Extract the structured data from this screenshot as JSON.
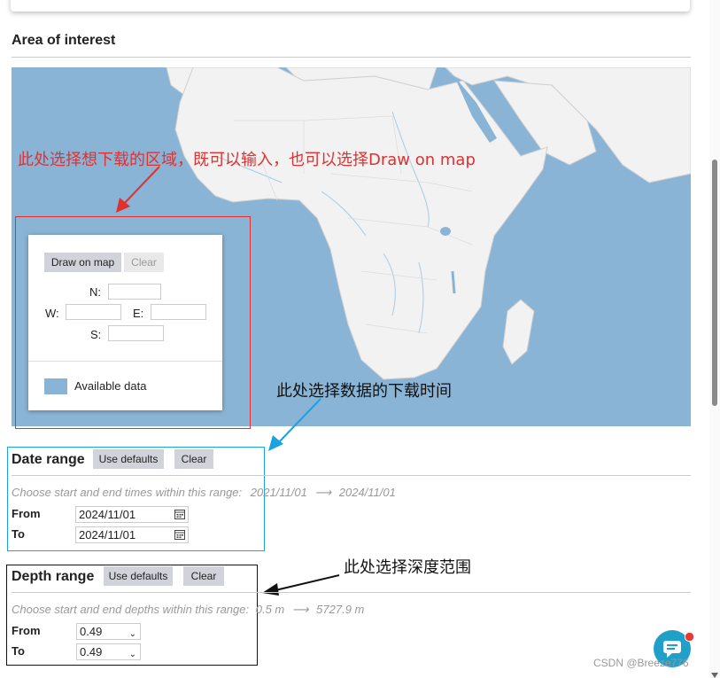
{
  "area": {
    "title": "Area of interest",
    "draw_button": "Draw on map",
    "clear_button": "Clear",
    "n_label": "N:",
    "w_label": "W:",
    "e_label": "E:",
    "s_label": "S:",
    "legend_label": "Available data",
    "legend_color": "#8ab4d6"
  },
  "annotations": {
    "area_note": "此处选择想下载的区域，既可以输入，也可以选择Draw on map",
    "date_note": "此处选择数据的下载时间",
    "depth_note": "此处选择深度范围",
    "area_color": "#e03030",
    "date_color": "#1aa3e0",
    "depth_color": "#111111"
  },
  "date_range": {
    "title": "Date range",
    "use_defaults": "Use defaults",
    "clear": "Clear",
    "hint": "Choose start and end times within this range:",
    "range_start": "2021/11/01",
    "arrow": "⟶",
    "range_end": "2024/11/01",
    "from_label": "From",
    "from_value": "2024/11/01",
    "to_label": "To",
    "to_value": "2024/11/01"
  },
  "depth_range": {
    "title": "Depth range",
    "use_defaults": "Use defaults",
    "clear": "Clear",
    "hint": "Choose start and end depths within this range:",
    "range_start": "0.5 m",
    "arrow": "⟶",
    "range_end": "5727.9 m",
    "from_label": "From",
    "from_value": "0.49",
    "to_label": "To",
    "to_value": "0.49"
  },
  "watermark": "CSDN @Breeze776"
}
